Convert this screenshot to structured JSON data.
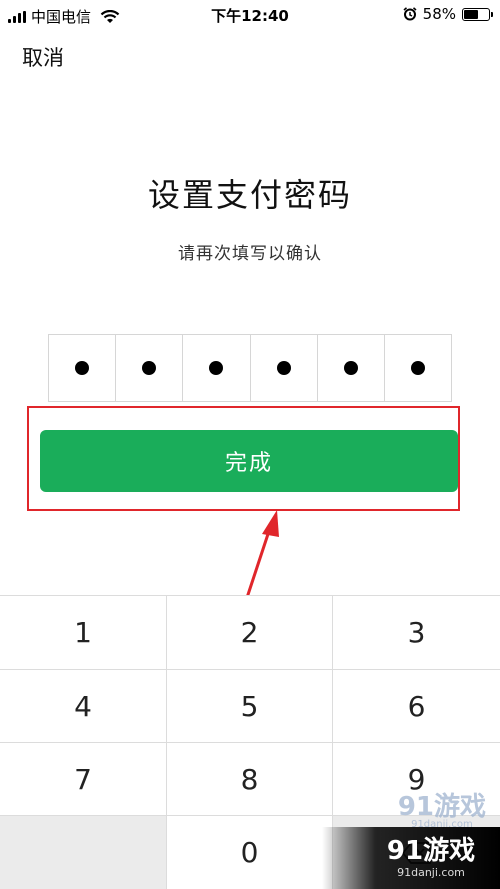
{
  "status_bar": {
    "carrier": "中国电信",
    "time": "下午12:40",
    "battery_percent": "58%",
    "battery_level": 0.58,
    "icons": [
      "signal-icon",
      "wifi-icon",
      "alarm-icon",
      "battery-icon"
    ]
  },
  "nav": {
    "cancel_label": "取消"
  },
  "header": {
    "title": "设置支付密码",
    "subtitle": "请再次填写以确认"
  },
  "pin": {
    "length": 6,
    "filled": 6
  },
  "actions": {
    "done_label": "完成",
    "done_color": "#1aad5a",
    "highlight_color": "#e0262b"
  },
  "keypad": {
    "keys": [
      "1",
      "2",
      "3",
      "4",
      "5",
      "6",
      "7",
      "8",
      "9",
      "",
      "0",
      ""
    ],
    "delete_icon": "backspace-icon"
  },
  "watermark": {
    "logo_text": "91游戏",
    "site": "91danji.com"
  },
  "corner_badge": {
    "logo_text": "91游戏",
    "site": "91danji.com"
  }
}
